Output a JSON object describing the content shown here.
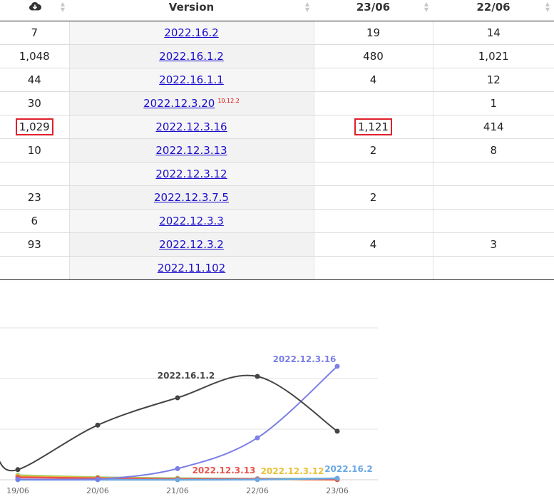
{
  "table": {
    "headers": [
      {
        "label": "",
        "icon": "download-cloud-icon"
      },
      {
        "label": "Version"
      },
      {
        "label": "23/06"
      },
      {
        "label": "22/06"
      }
    ],
    "rows": [
      {
        "total": "7",
        "version": "2022.16.2",
        "note": "",
        "d2306": "19",
        "d2206": "14",
        "hl_total": false,
        "hl_2306": false
      },
      {
        "total": "1,048",
        "version": "2022.16.1.2",
        "note": "",
        "d2306": "480",
        "d2206": "1,021",
        "hl_total": false,
        "hl_2306": false
      },
      {
        "total": "44",
        "version": "2022.16.1.1",
        "note": "",
        "d2306": "4",
        "d2206": "12",
        "hl_total": false,
        "hl_2306": false
      },
      {
        "total": "30",
        "version": "2022.12.3.20",
        "note": "10.12.2",
        "d2306": "",
        "d2206": "1",
        "hl_total": false,
        "hl_2306": false
      },
      {
        "total": "1,029",
        "version": "2022.12.3.16",
        "note": "",
        "d2306": "1,121",
        "d2206": "414",
        "hl_total": true,
        "hl_2306": true
      },
      {
        "total": "10",
        "version": "2022.12.3.13",
        "note": "",
        "d2306": "2",
        "d2206": "8",
        "hl_total": false,
        "hl_2306": false
      },
      {
        "total": "",
        "version": "2022.12.3.12",
        "note": "",
        "d2306": "",
        "d2206": "",
        "hl_total": false,
        "hl_2306": false
      },
      {
        "total": "23",
        "version": "2022.12.3.7.5",
        "note": "",
        "d2306": "2",
        "d2206": "",
        "hl_total": false,
        "hl_2306": false
      },
      {
        "total": "6",
        "version": "2022.12.3.3",
        "note": "",
        "d2306": "",
        "d2206": "",
        "hl_total": false,
        "hl_2306": false
      },
      {
        "total": "93",
        "version": "2022.12.3.2",
        "note": "",
        "d2306": "4",
        "d2206": "3",
        "hl_total": false,
        "hl_2306": false
      },
      {
        "total": "",
        "version": "2022.11.102",
        "note": "",
        "d2306": "",
        "d2206": "",
        "hl_total": false,
        "hl_2306": false
      }
    ],
    "highlight_color": "#e0202a",
    "link_color": "#1a0dcc"
  },
  "chart_data": {
    "type": "line",
    "categories": [
      "19/06",
      "20/06",
      "21/06",
      "22/06",
      "23/06"
    ],
    "ylim": [
      0,
      1500
    ],
    "grid": true,
    "series": [
      {
        "name": "2022.16.1.2",
        "color": "#444444",
        "label_color": "#444444",
        "values": [
          100,
          540,
          810,
          1021,
          480
        ],
        "label_at": 2
      },
      {
        "name": "2022.12.3.16",
        "color": "#7b7fe6",
        "label_color": "#7b7fe6",
        "values": [
          5,
          5,
          110,
          414,
          1121
        ],
        "label_at": 4
      },
      {
        "name": "2022.12.3.13",
        "color": "#e8534b",
        "label_color": "#e8534b",
        "values": [
          25,
          15,
          8,
          8,
          2
        ],
        "label_at": 2
      },
      {
        "name": "2022.12.3.12",
        "color": "#e8c23a",
        "label_color": "#e8c23a",
        "values": [
          35,
          20,
          10,
          5,
          0
        ],
        "label_at": 3
      },
      {
        "name": "2022.16.2",
        "color": "#6aa9e4",
        "label_color": "#6aa9e4",
        "values": [
          0,
          0,
          0,
          2,
          14
        ],
        "label_at": 4
      },
      {
        "name": "",
        "color": "#8fd17a",
        "label_color": "#8fd17a",
        "values": [
          45,
          25,
          15,
          10,
          12
        ],
        "label_at": -1
      }
    ]
  }
}
